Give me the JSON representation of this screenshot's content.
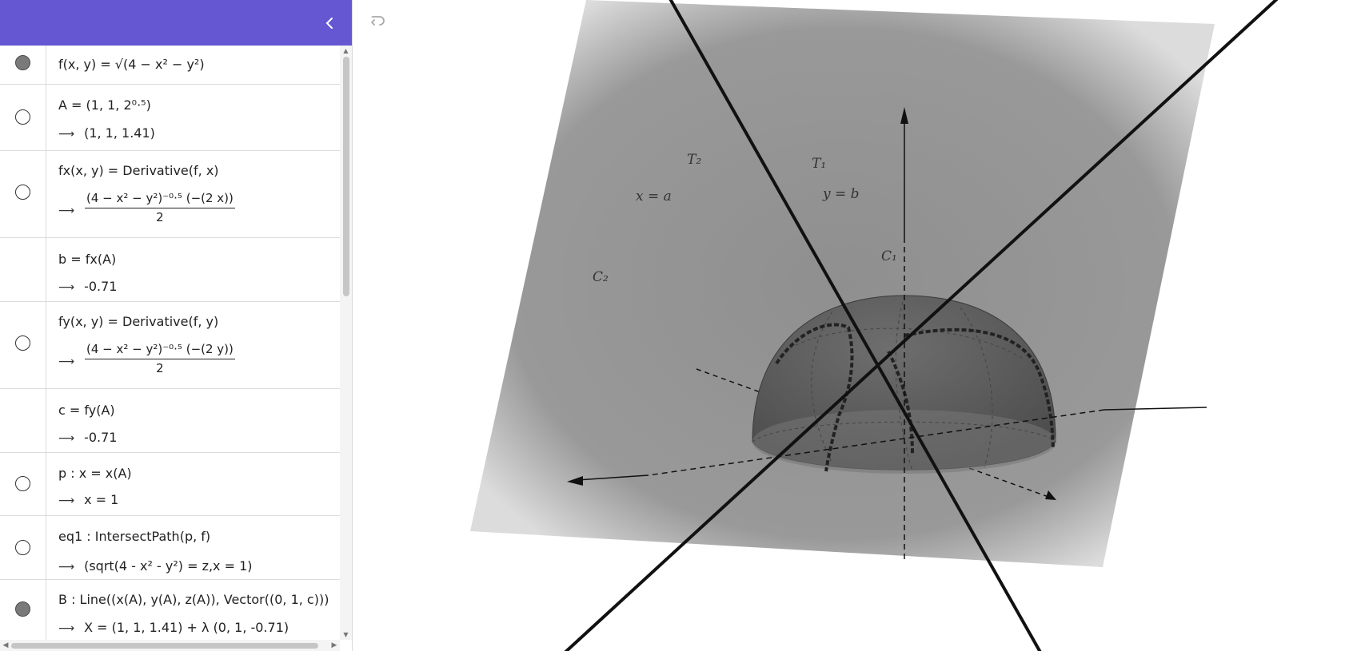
{
  "header": {
    "color": "#6557d2",
    "collapse_icon": "chevron-left-icon"
  },
  "rows": [
    {
      "marble": "on",
      "text": "f(x, y)  =  √(4 − x² − y²)"
    },
    {
      "marble": "off",
      "text": "A  =  (1, 1, 2⁰·⁵)",
      "result": "(1,  1,  1.41)"
    },
    {
      "marble": "off",
      "text": "fx(x, y)  =  Derivative(f, x)",
      "frac_num": "(4 − x² − y²)⁻⁰·⁵ (−(2 x))",
      "frac_den": "2"
    },
    {
      "marble": "none",
      "text": "b  =  fx(A)",
      "result": "-0.71"
    },
    {
      "marble": "off",
      "text": "fy(x, y)  =  Derivative(f, y)",
      "frac_num": "(4 − x² − y²)⁻⁰·⁵ (−(2 y))",
      "frac_den": "2"
    },
    {
      "marble": "none",
      "text": "c  =  fy(A)",
      "result": "-0.71"
    },
    {
      "marble": "off",
      "text": "p : x  =  x(A)",
      "result": "x = 1"
    },
    {
      "marble": "off",
      "text": "eq1 : IntersectPath(p, f)",
      "result": "(sqrt(4 - x² - y²) = z,x = 1)"
    },
    {
      "marble": "on",
      "text": "B : Line((x(A), y(A), z(A)), Vector((0, 1, c)))",
      "result": "X = (1,  1,  1.41) + λ (0,  1,  -0.71)"
    }
  ],
  "result_arrow": "⟶",
  "graphics": {
    "undo_icon": "undo-icon",
    "labels": {
      "T2": "T₂",
      "T1": "T₁",
      "x_eq_a": "x = a",
      "y_eq_b": "y = b",
      "C1": "C₁",
      "C2": "C₂"
    },
    "colors": {
      "plane": "#9b9b9b",
      "surface": "#5a5a5a",
      "lines": "#111111"
    }
  }
}
